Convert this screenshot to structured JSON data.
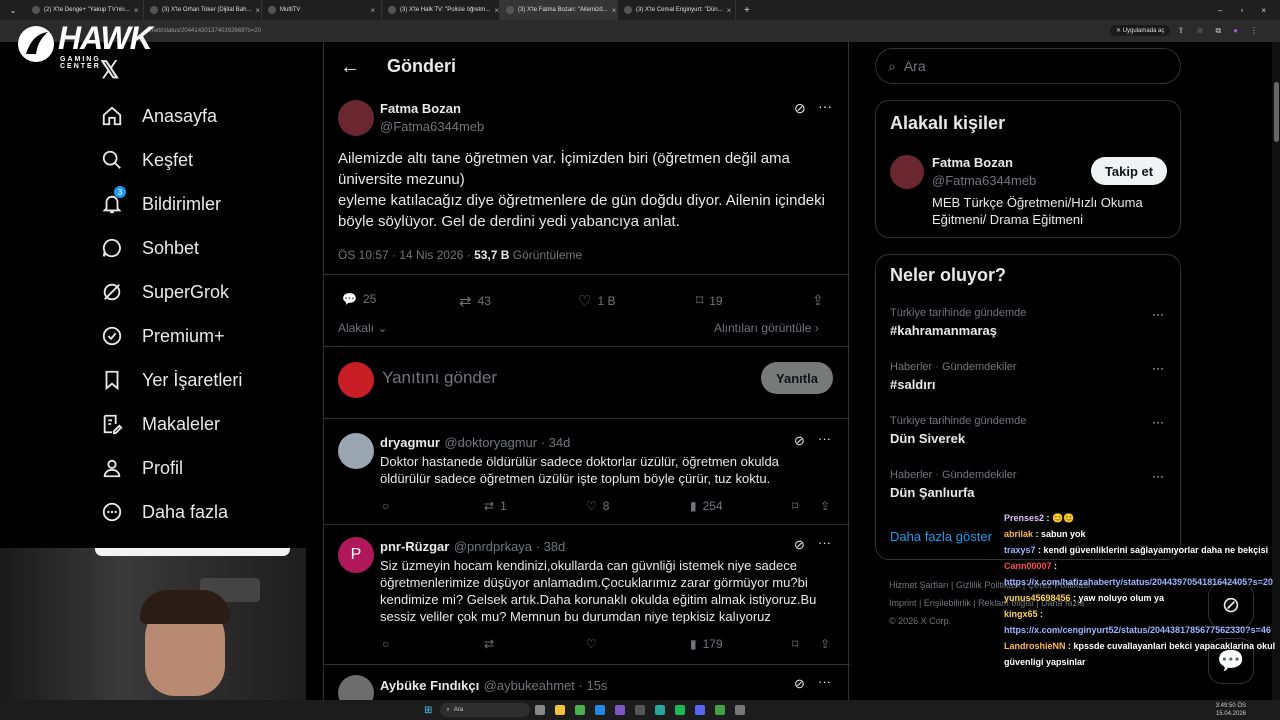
{
  "browser": {
    "tabs": [
      {
        "label": "(2) X'te Denge+ \"Yakup TV'nin...",
        "active": false
      },
      {
        "label": "(3) X'te Orhan Toker (Dijital Bah...",
        "active": false
      },
      {
        "label": "MultiTV",
        "active": false
      },
      {
        "label": "(3) X'te Halk TV: \"Polisle öğretm...",
        "active": false
      },
      {
        "label": "(3) X'te Fatma Bozan: \"Ailemizd...",
        "active": true
      },
      {
        "label": "(3) X'te Cemal Enginyurt: \"Dün...",
        "active": false
      }
    ],
    "url": "...meb/status/2044143013740392669?s=20",
    "app_chip": "Uygulamada aç"
  },
  "overlay": {
    "logo_text": "HAWK",
    "logo_sub": "GAMING CENTER"
  },
  "sidebar": {
    "items": [
      {
        "label": "Anasayfa",
        "icon": "home-icon"
      },
      {
        "label": "Keşfet",
        "icon": "search-icon"
      },
      {
        "label": "Bildirimler",
        "icon": "bell-icon",
        "badge": "3"
      },
      {
        "label": "Sohbet",
        "icon": "chat-icon"
      },
      {
        "label": "SuperGrok",
        "icon": "grok-icon"
      },
      {
        "label": "Premium+",
        "icon": "verified-icon"
      },
      {
        "label": "Yer İşaretleri",
        "icon": "bookmark-icon"
      },
      {
        "label": "Makaleler",
        "icon": "article-icon"
      },
      {
        "label": "Profil",
        "icon": "person-icon"
      },
      {
        "label": "Daha fazla",
        "icon": "more-circle-icon"
      }
    ]
  },
  "post": {
    "header": "Gönderi",
    "author_name": "Fatma Bozan",
    "author_handle": "@Fatma6344meb",
    "text_lines": [
      "Ailemizde altı tane öğretmen var. İçimizden biri (öğretmen değil ama",
      "üniversite mezunu)",
      "eyleme katılacağız diye öğretmenlere de gün doğdu diyor. Ailenin içindeki",
      "böyle söylüyor. Gel de derdini yedi yabancıya anlat."
    ],
    "time": "ÖS 10:57 · 14 Nis 2026 ·",
    "views_count": "53,7 B",
    "views_label": "Görüntüleme",
    "replies": "25",
    "reposts": "43",
    "likes": "1 B",
    "bookmarks": "19",
    "relevant_label": "Alakalı",
    "quotes_label": "Alıntıları görüntüle",
    "reply_placeholder": "Yanıtını gönder",
    "reply_button": "Yanıtla"
  },
  "replies": [
    {
      "name": "dryagmur",
      "handle": "@doktoryagmur · 34d",
      "lines": [
        "Doktor hastanede öldürülür sadece doktorlar üzülür, öğretmen okulda",
        "öldürülür sadece öğretmen üzülür işte toplum böyle çürür, tuz koktu."
      ],
      "replies": "",
      "reposts": "1",
      "likes": "8",
      "views": "254"
    },
    {
      "name": "pnr-Rüzgar",
      "handle": "@pnrdprkaya · 38d",
      "avatar_letter": "P",
      "lines": [
        "Siz üzmeyin hocam kendinizi,okullarda can güvnliği istemek niye sadece",
        "öğretmenlerimize düşüyor anlamadım.Çocuklarımız zarar görmüyor mu?bi",
        "kendimize mi? Gelsek artık.Daha korunaklı okulda eğitim almak istiyoruz.Bu",
        "sessiz veliler çok mu? Memnun bu durumdan niye tepkisiz kalıyoruz"
      ],
      "replies": "",
      "reposts": "",
      "likes": "",
      "views": "179"
    },
    {
      "name": "Aybüke Fındıkçı",
      "handle": "@aybukeahmet · 15s",
      "lines": [],
      "replies": "",
      "reposts": "",
      "likes": "",
      "views": ""
    }
  ],
  "right": {
    "search_placeholder": "Ara",
    "people_title": "Alakalı kişiler",
    "person_name": "Fatma Bozan",
    "person_handle": "@Fatma6344meb",
    "person_bio": "MEB Türkçe Öğretmeni/Hızlı Okuma Eğitmeni/ Drama Eğitmeni",
    "follow_button": "Takip et",
    "trends_title": "Neler oluyor?",
    "trends": [
      {
        "category": "Türkiye tarihinde gündemde",
        "name": "#kahramanmaraş"
      },
      {
        "category": "Haberler · Gündemdekiler",
        "name": "#saldırı"
      },
      {
        "category": "Türkiye tarihinde gündemde",
        "name": "Dün Siverek"
      },
      {
        "category": "Haberler · Gündemdekiler",
        "name": "Dün Şanlıurfa"
      }
    ],
    "show_more": "Daha fazla göster",
    "footer_lines": [
      "Hizmet Şartları  |  Gizlilik Politikası  |  Çerez Politikası",
      "Imprint  |  Erişilebilirlik  |  Reklam bilgisi  |  Daha fazla ···",
      "© 2026 X Corp."
    ]
  },
  "chat": [
    {
      "user": "Prenses2",
      "color": "#e0c0ff",
      "text": " : 😊😊"
    },
    {
      "user": "abrilak",
      "color": "#ffb84d",
      "text": " : sabun yok"
    },
    {
      "user": "traxys7",
      "color": "#9ab6ff",
      "text": " : kendi güvenliklerini sağlayamıyorlar daha ne bekçisi"
    },
    {
      "user": "Cann00007",
      "color": "#ff4d4d",
      "text": " :"
    },
    {
      "user": "",
      "color": "#9ab6ff",
      "text": "https://x.com/hafizahaberty/status/2044397054181642405?s=20"
    },
    {
      "user": "yunus45698456",
      "color": "#ffd54d",
      "text": " : yaw noluyo olum ya"
    },
    {
      "user": "kingx65",
      "color": "#ffd54d",
      "text": " :"
    },
    {
      "user": "",
      "color": "#9ab6ff",
      "text": "https://x.com/cenginyurt52/status/2044381785677562330?s=46"
    },
    {
      "user": "LandroshieNN",
      "color": "#ffb84d",
      "text": " : kpssde cuvallayanlari bekci yapacaklarina okul güvenligi yapsinlar"
    }
  ],
  "taskbar": {
    "search_placeholder": "Ara",
    "time": "3:49:50 ÖS",
    "date": "15.04.2026"
  }
}
